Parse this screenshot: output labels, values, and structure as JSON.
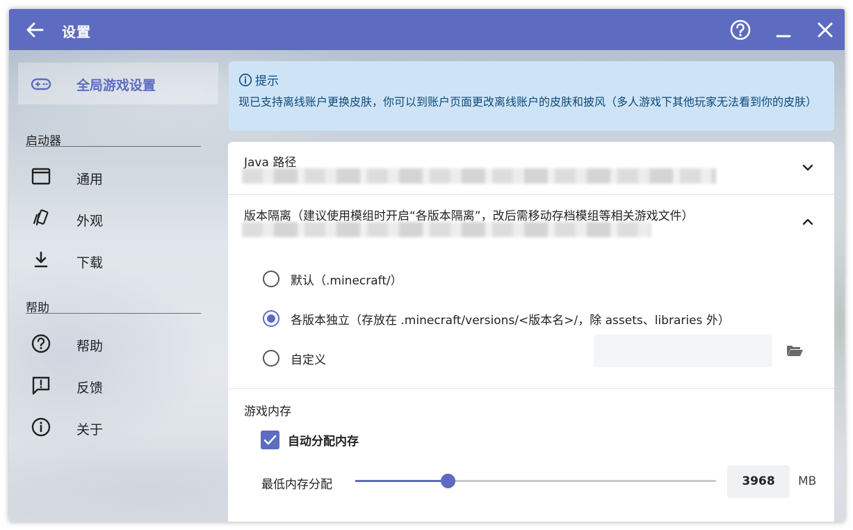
{
  "titlebar": {
    "title": "设置",
    "back_icon": "arrow-left-icon",
    "help_icon": "help-circle-icon",
    "minimize_icon": "minimize-icon",
    "close_icon": "close-icon"
  },
  "sidebar": {
    "selected": {
      "label": "全局游戏设置",
      "icon": "gamepad-icon"
    },
    "sections": [
      {
        "title": "启动器",
        "items": [
          {
            "label": "通用",
            "icon": "window-icon"
          },
          {
            "label": "外观",
            "icon": "paint-icon"
          },
          {
            "label": "下载",
            "icon": "download-icon"
          }
        ]
      },
      {
        "title": "帮助",
        "items": [
          {
            "label": "帮助",
            "icon": "help-circle-icon"
          },
          {
            "label": "反馈",
            "icon": "feedback-icon"
          },
          {
            "label": "关于",
            "icon": "info-icon"
          }
        ]
      }
    ]
  },
  "tip": {
    "title": "提示",
    "body": "现已支持离线账户更换皮肤，你可以到账户页面更改离线账户的皮肤和披风（多人游戏下其他玩家无法看到你的皮肤）"
  },
  "java": {
    "title": "Java 路径"
  },
  "isolation": {
    "title": "版本隔离（建议使用模组时开启“各版本隔离”，改后需移动存档模组等相关游戏文件）",
    "options": [
      {
        "label": "默认（.minecraft/）",
        "selected": false
      },
      {
        "label": "各版本独立（存放在 .minecraft/versions/<版本名>/，除 assets、libraries 外）",
        "selected": true
      },
      {
        "label": "自定义",
        "selected": false
      }
    ],
    "custom_placeholder": ""
  },
  "memory": {
    "title": "游戏内存",
    "auto_label": "自动分配内存",
    "auto_checked": true,
    "min_label": "最低内存分配",
    "value": "3968",
    "unit": "MB",
    "slider_fraction": 0.257,
    "usage_fraction": 0.846
  },
  "colors": {
    "accent": "#5d6bc0",
    "tip_bg": "#cfe3f6",
    "tip_text": "#0c4a7a"
  }
}
